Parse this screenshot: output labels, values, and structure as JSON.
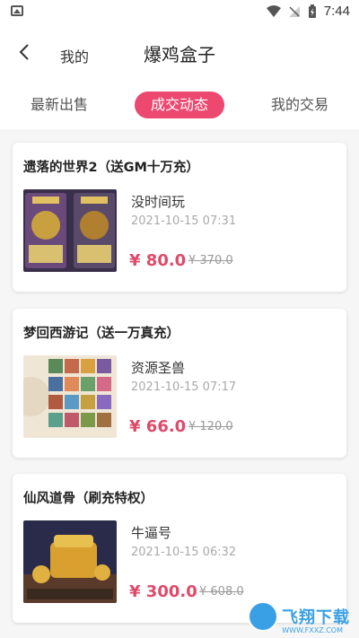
{
  "status_bar": {
    "time": "7:44"
  },
  "header": {
    "back_label": "我的",
    "title": "爆鸡盒子"
  },
  "tabs": [
    {
      "label": "最新出售",
      "active": false
    },
    {
      "label": "成交动态",
      "active": true
    },
    {
      "label": "我的交易",
      "active": false
    }
  ],
  "colors": {
    "accent": "#ec4870",
    "price": "#e04a6a"
  },
  "deals": [
    {
      "game": "遗落的世界2（送GM十万充）",
      "seller": "没时间玩",
      "time": "2021-10-15 07:31",
      "price": "¥ 80.0",
      "original_price": "¥ 370.0"
    },
    {
      "game": "梦回西游记（送一万真充）",
      "seller": "资源圣兽",
      "time": "2021-10-15 07:17",
      "price": "¥ 66.0",
      "original_price": "¥ 120.0"
    },
    {
      "game": "仙风道骨（刷充特权）",
      "seller": "牛逼号",
      "time": "2021-10-15 06:32",
      "price": "¥ 300.0",
      "original_price": "¥ 608.0"
    }
  ],
  "watermark": {
    "text": "飞翔下载",
    "sub": "WWW.FXXZ.COM"
  }
}
